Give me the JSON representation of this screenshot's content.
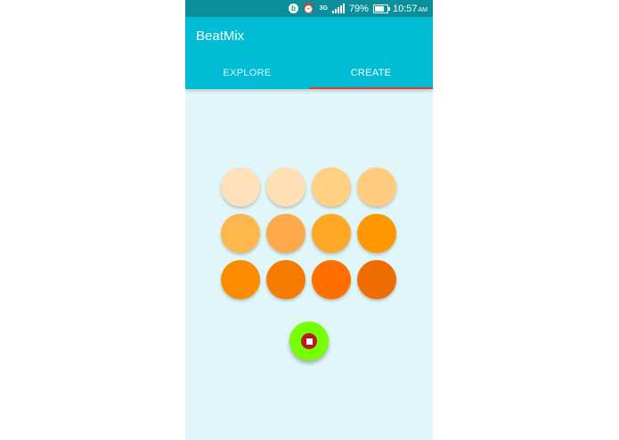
{
  "status_bar": {
    "beats_icon": "beats-icon",
    "beats_glyph": "b",
    "alarm_icon": "alarm-clock-icon",
    "network_label": "3G",
    "signal_icon": "cell-signal-icon",
    "battery_percent": "79%",
    "battery_icon": "battery-icon",
    "battery_level": 0.79,
    "time": "10:57",
    "ampm": "AM"
  },
  "app_bar": {
    "title": "BeatMix"
  },
  "tabs": [
    {
      "label": "EXPLORE",
      "active": false
    },
    {
      "label": "CREATE",
      "active": true
    }
  ],
  "pads": [
    {
      "color": "#ffe0b9"
    },
    {
      "color": "#ffe0b4"
    },
    {
      "color": "#ffd081"
    },
    {
      "color": "#ffcc80"
    },
    {
      "color": "#ffb74d"
    },
    {
      "color": "#ffa94d"
    },
    {
      "color": "#ffa726"
    },
    {
      "color": "#ff9800"
    },
    {
      "color": "#fb8c00"
    },
    {
      "color": "#f57c00"
    },
    {
      "color": "#ff6f00"
    },
    {
      "color": "#ef6c00"
    }
  ],
  "fab": {
    "icon": "stop-icon",
    "background": "#76ff03",
    "ring_color": "#b71c1c"
  },
  "colors": {
    "status_bar": "#0b8f9a",
    "app_bar": "#00bcd4",
    "tab_indicator": "#e53935",
    "content_background": "#e0f6f8"
  }
}
